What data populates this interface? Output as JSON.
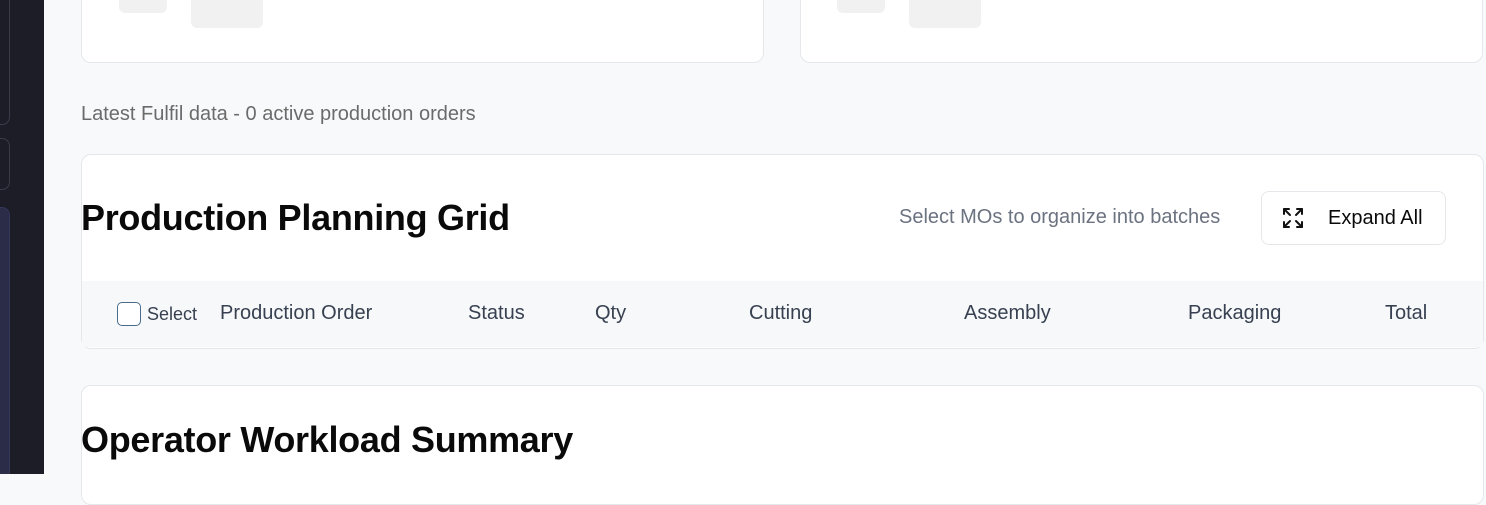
{
  "status_line": "Latest Fulfil data - 0 active production orders",
  "planning_grid": {
    "title": "Production Planning Grid",
    "hint": "Select MOs to organize into batches",
    "expand_button_label": "Expand All",
    "expand_icon": "expand-icon",
    "select_label": "Select",
    "columns": [
      "Production Order",
      "Status",
      "Qty",
      "Cutting",
      "Assembly",
      "Packaging",
      "Total"
    ],
    "rows": []
  },
  "workload": {
    "title": "Operator Workload Summary"
  },
  "colors": {
    "sidebar_bg": "#1c1d27",
    "page_bg": "#f8f9fa",
    "card_bg": "#ffffff",
    "muted_text": "#6b7280",
    "checkbox_border": "#4a6b8a"
  }
}
